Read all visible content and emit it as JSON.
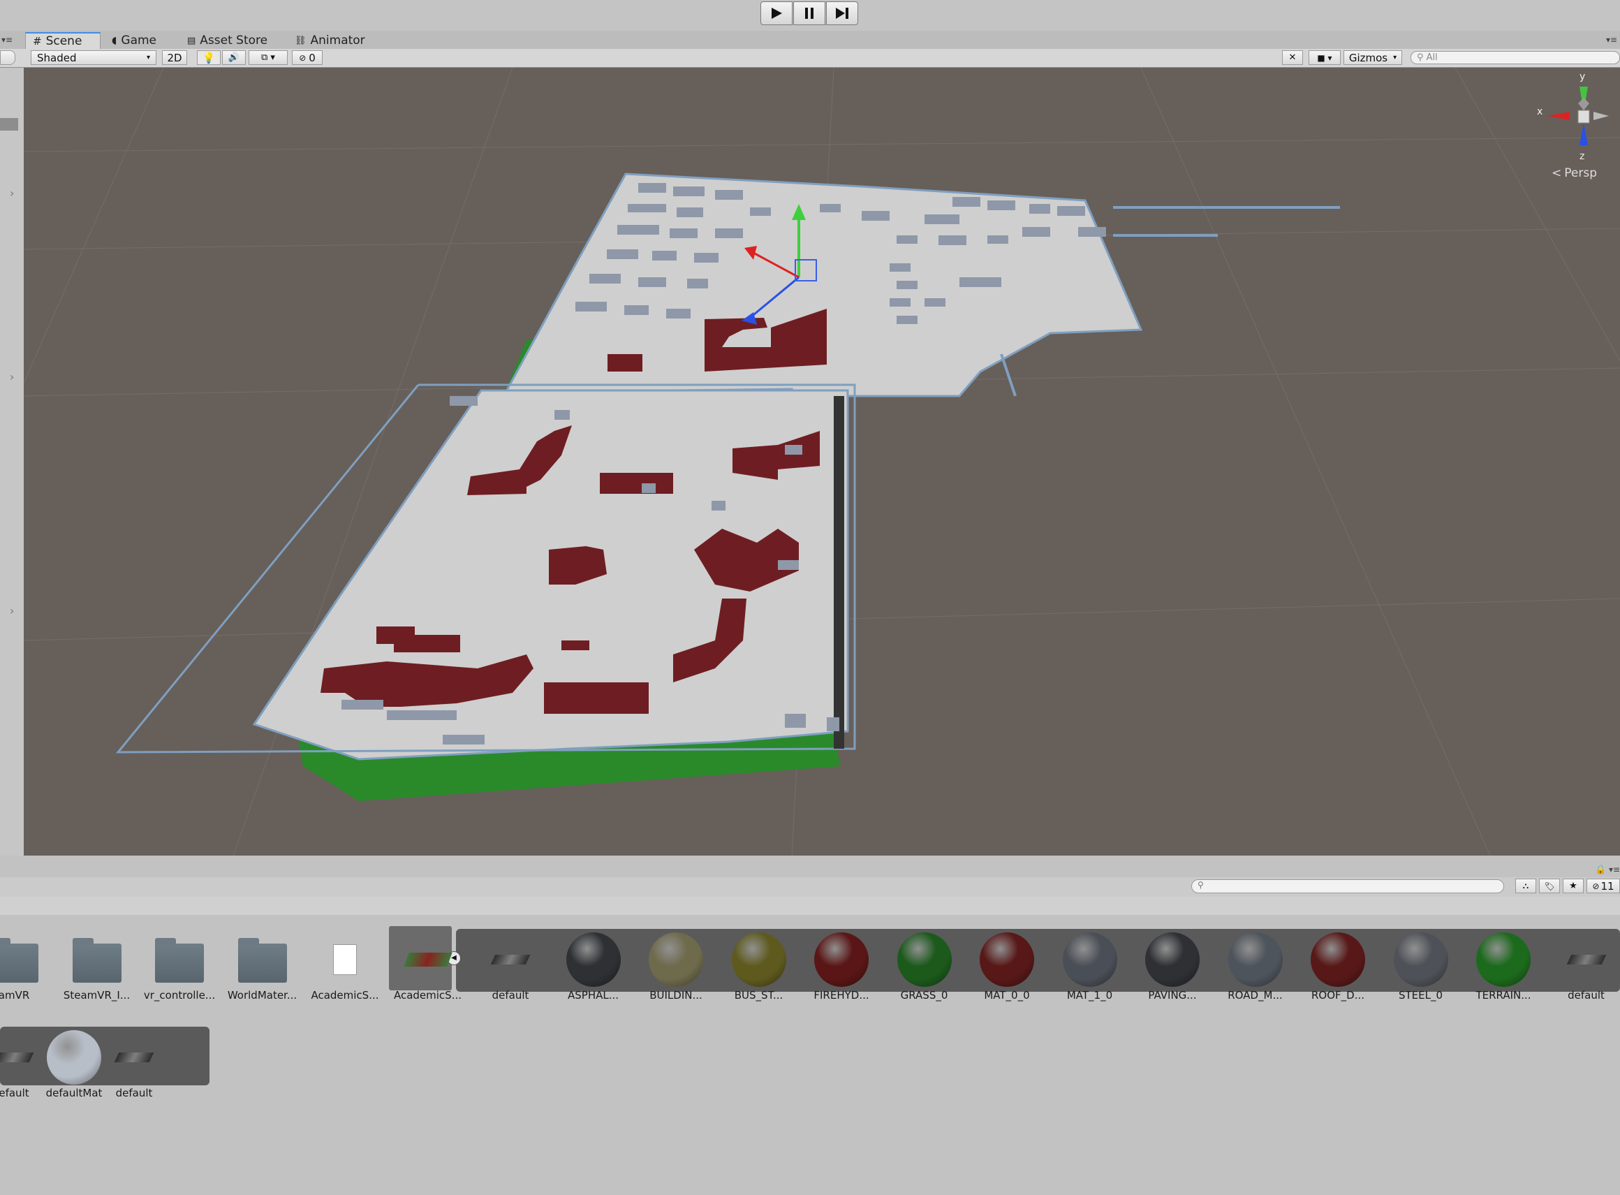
{
  "playbar": {
    "play_icon": "play-icon",
    "pause_icon": "pause-icon",
    "step_icon": "step-icon"
  },
  "tabs": [
    {
      "label": "Scene",
      "icon": "hash-icon",
      "active": true
    },
    {
      "label": "Game",
      "icon": "pacman-icon",
      "active": false
    },
    {
      "label": "Asset Store",
      "icon": "store-icon",
      "active": false
    },
    {
      "label": "Animator",
      "icon": "animator-icon",
      "active": false
    }
  ],
  "scene_toolbar": {
    "draw_mode": "Shaded",
    "mode_2d": "2D",
    "hidden_count": "0",
    "gizmos_label": "Gizmos",
    "search_placeholder": "All"
  },
  "gizmo": {
    "y": "y",
    "x": "x",
    "z": "z",
    "projection": "Persp"
  },
  "project": {
    "hidden_count": "11",
    "assets_row1": [
      {
        "label": "amVR",
        "kind": "folder"
      },
      {
        "label": "SteamVR_I...",
        "kind": "folder"
      },
      {
        "label": "vr_controlle...",
        "kind": "folder"
      },
      {
        "label": "WorldMater...",
        "kind": "folder"
      },
      {
        "label": "AcademicS...",
        "kind": "file"
      },
      {
        "label": "AcademicS...",
        "kind": "model"
      },
      {
        "label": "default",
        "kind": "mesh"
      },
      {
        "label": "ASPHAL...",
        "kind": "material",
        "color": "#2e3034"
      },
      {
        "label": "BUILDIN...",
        "kind": "material",
        "color": "#6e6a4c"
      },
      {
        "label": "BUS_ST...",
        "kind": "material",
        "color": "#5e5a1e"
      },
      {
        "label": "FIREHYD...",
        "kind": "material",
        "color": "#5a1616"
      },
      {
        "label": "GRASS_0",
        "kind": "material",
        "color": "#1c5a1c"
      },
      {
        "label": "MAT_0_0",
        "kind": "material",
        "color": "#581818"
      },
      {
        "label": "MAT_1_0",
        "kind": "material",
        "color": "#4a4e56"
      },
      {
        "label": "PAVING...",
        "kind": "material",
        "color": "#2e3034"
      },
      {
        "label": "ROAD_M...",
        "kind": "material",
        "color": "#4e545c"
      },
      {
        "label": "ROOF_D...",
        "kind": "material",
        "color": "#581818"
      },
      {
        "label": "STEEL_0",
        "kind": "material",
        "color": "#4e5258"
      },
      {
        "label": "TERRAIN...",
        "kind": "material",
        "color": "#1c6a1c"
      },
      {
        "label": "default",
        "kind": "mesh"
      }
    ],
    "assets_row2": [
      {
        "label": "efault",
        "kind": "mesh"
      },
      {
        "label": "defaultMat",
        "kind": "material",
        "color": "#b8bec8"
      },
      {
        "label": "default",
        "kind": "mesh"
      }
    ]
  }
}
